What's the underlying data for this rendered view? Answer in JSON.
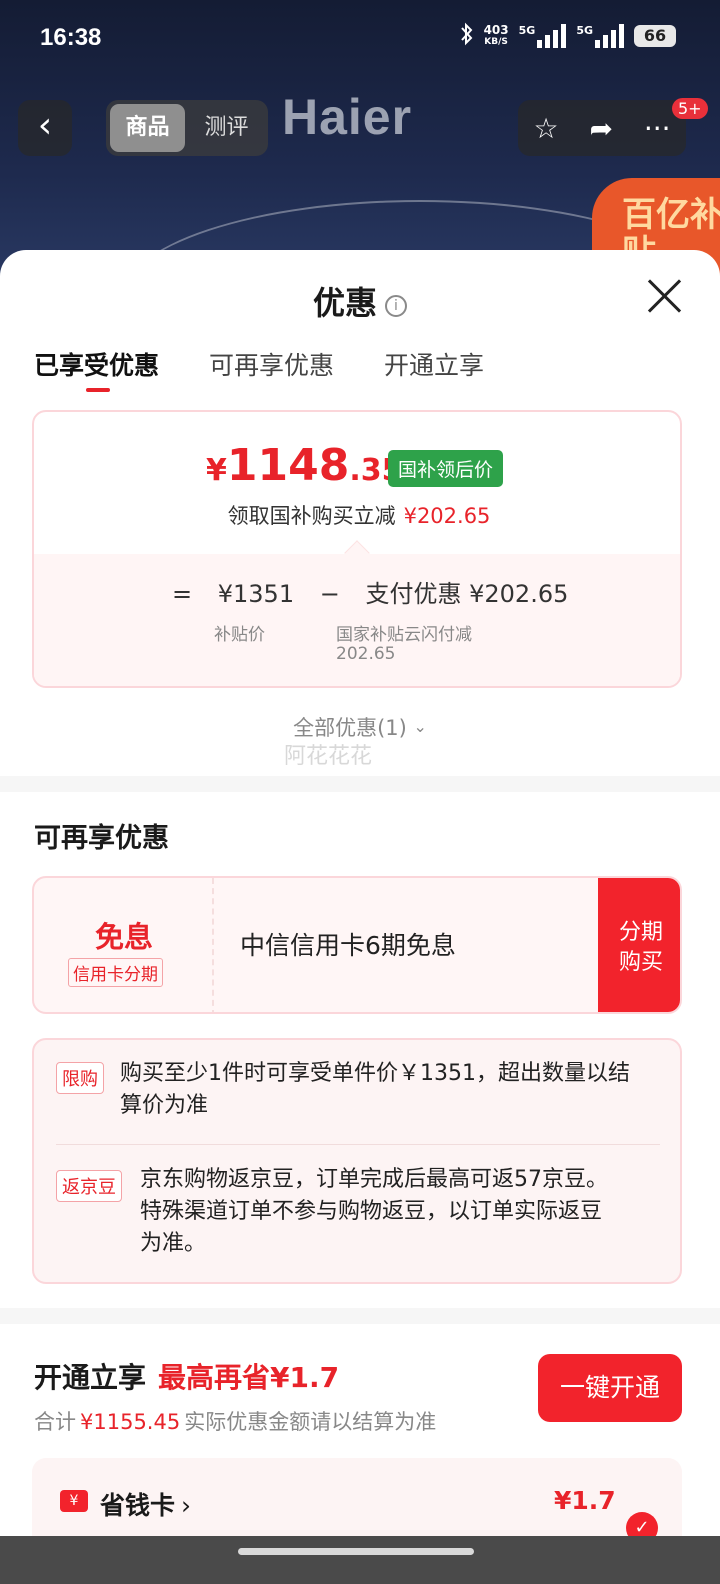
{
  "status": {
    "time": "16:38",
    "speed_value": "403",
    "speed_unit": "KB/S",
    "battery": "66",
    "net1": "5G",
    "net2": "5G"
  },
  "product_header": {
    "brand": "Haier",
    "tabs": [
      "商品",
      "测评"
    ],
    "badge": "5+",
    "corner_badge": "百亿补贴"
  },
  "sheet": {
    "title": "优惠",
    "tabs": [
      {
        "label": "已享受优惠",
        "active": true
      },
      {
        "label": "可再享优惠",
        "active": false
      },
      {
        "label": "开通立享",
        "active": false
      }
    ],
    "price": {
      "currency": "¥",
      "integer": "1148",
      "decimal": ".35",
      "tag": "国补领后价",
      "sub_label": "领取国补购买立减",
      "sub_amount": "¥202.65"
    },
    "formula": {
      "eq": "=",
      "base": "¥1351",
      "minus": "−",
      "discount": "支付优惠 ¥202.65",
      "base_note": "补贴价",
      "discount_note_line1": "国家补贴云闪付减",
      "discount_note_line2": "202.65"
    },
    "all_discounts": "全部优惠(1)",
    "watermark": "阿花花花"
  },
  "more_discounts": {
    "title": "可再享优惠",
    "credit": {
      "title": "免息",
      "tag": "信用卡分期",
      "desc": "中信信用卡6期免息",
      "button_line1": "分期",
      "button_line2": "购买"
    },
    "rules": [
      {
        "tag": "限购",
        "line1": "购买至少1件时可享受单件价￥1351，超出数量以结",
        "line2": "算价为准"
      },
      {
        "tag": "返京豆",
        "line1": "京东购物返京豆，订单完成后最高可返57京豆。",
        "line2": "特殊渠道订单不参与购物返豆，以订单实际返豆",
        "line3": "为准。"
      }
    ]
  },
  "open_now": {
    "title": "开通立享",
    "highlight": "最高再省¥1.7",
    "sub_prefix": "合计",
    "sub_total": "¥1155.45",
    "sub_suffix": "实际优惠金额请以结算为准",
    "button": "一键开通",
    "card_name": "省钱卡",
    "card_amount": "¥1.7"
  }
}
